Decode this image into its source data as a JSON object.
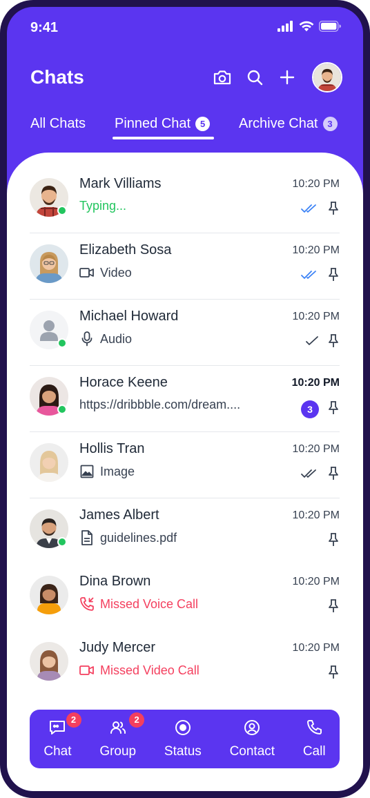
{
  "status_bar": {
    "time": "9:41"
  },
  "header": {
    "title": "Chats"
  },
  "tabs": [
    {
      "label": "All Chats",
      "badge": ""
    },
    {
      "label": "Pinned Chat",
      "badge": "5"
    },
    {
      "label": "Archive Chat",
      "badge": "3"
    }
  ],
  "chats": [
    {
      "name": "Mark Villiams",
      "time": "10:20 PM",
      "message": "Typing...",
      "type": "typing",
      "online": true,
      "status": "read",
      "unread": ""
    },
    {
      "name": "Elizabeth Sosa",
      "time": "10:20 PM",
      "message": "Video",
      "type": "video",
      "online": false,
      "status": "read",
      "unread": ""
    },
    {
      "name": "Michael Howard",
      "time": "10:20 PM",
      "message": "Audio",
      "type": "audio",
      "online": true,
      "status": "sent",
      "unread": ""
    },
    {
      "name": "Horace Keene",
      "time": "10:20 PM",
      "message": "https://dribbble.com/dream....",
      "type": "link",
      "online": true,
      "status": "unread",
      "unread": "3"
    },
    {
      "name": "Hollis Tran",
      "time": "10:20 PM",
      "message": "Image",
      "type": "image",
      "online": false,
      "status": "delivered",
      "unread": ""
    },
    {
      "name": "James Albert",
      "time": "10:20 PM",
      "message": "guidelines.pdf",
      "type": "file",
      "online": true,
      "status": "none",
      "unread": ""
    },
    {
      "name": "Dina Brown",
      "time": "10:20 PM",
      "message": "Missed Voice Call",
      "type": "missed-voice",
      "online": false,
      "status": "none",
      "unread": ""
    },
    {
      "name": "Judy Mercer",
      "time": "10:20 PM",
      "message": "Missed Video Call",
      "type": "missed-video",
      "online": false,
      "status": "none",
      "unread": ""
    }
  ],
  "bottom_nav": [
    {
      "label": "Chat",
      "badge": "2",
      "icon": "chat-icon"
    },
    {
      "label": "Group",
      "badge": "2",
      "icon": "group-icon"
    },
    {
      "label": "Status",
      "badge": "",
      "icon": "status-icon"
    },
    {
      "label": "Contact",
      "badge": "",
      "icon": "contact-icon"
    },
    {
      "label": "Call",
      "badge": "",
      "icon": "call-icon"
    }
  ],
  "colors": {
    "primary": "#5b35f0",
    "online": "#22c55e",
    "missed": "#f43f5e",
    "read_ticks": "#3b82f6"
  }
}
